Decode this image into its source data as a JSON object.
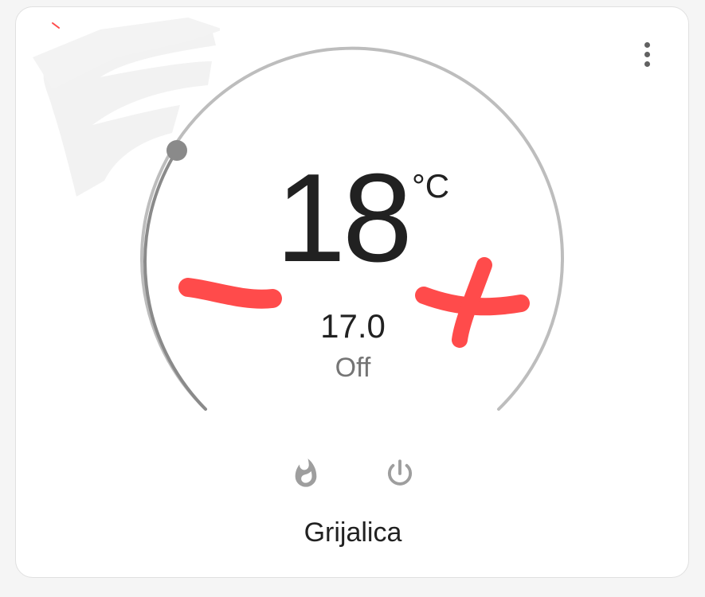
{
  "card": {
    "target_temperature": "18",
    "unit": "°C",
    "current_temperature": "17.0",
    "hvac_state": "Off",
    "name": "Grijalica",
    "target_level_fraction": 0.2
  },
  "icons": {
    "menu": "more-vertical-icon",
    "heat": "fire-icon",
    "power": "power-icon"
  },
  "colors": {
    "arc_track": "#bdbdbd",
    "arc_active": "#8a8a8a",
    "handle": "#8a8a8a",
    "icon": "#9e9e9e",
    "annotation": "#ff4b4b"
  }
}
